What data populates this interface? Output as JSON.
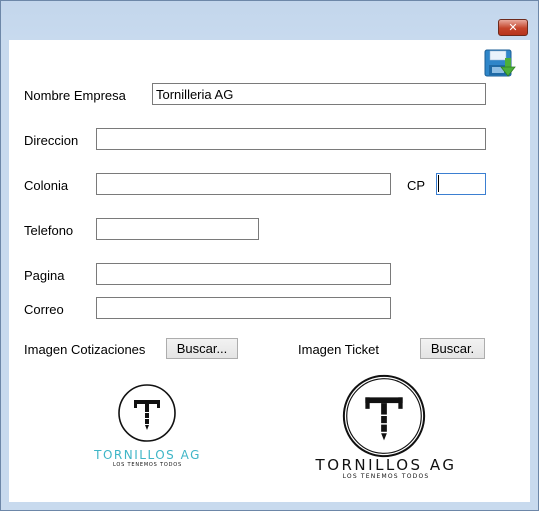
{
  "window": {
    "close_glyph": "✕"
  },
  "toolbar": {
    "save_icon": "save-disk-icon"
  },
  "form": {
    "nombre_empresa": {
      "label": "Nombre Empresa",
      "value": "Tornilleria AG"
    },
    "direccion": {
      "label": "Direccion",
      "value": ""
    },
    "colonia": {
      "label": "Colonia",
      "value": ""
    },
    "cp": {
      "label": "CP",
      "value": ""
    },
    "telefono": {
      "label": "Telefono",
      "value": ""
    },
    "pagina": {
      "label": "Pagina",
      "value": ""
    },
    "correo": {
      "label": "Correo",
      "value": ""
    }
  },
  "images": {
    "cotizaciones": {
      "label": "Imagen Cotizaciones",
      "button": "Buscar..."
    },
    "ticket": {
      "label": "Imagen Ticket",
      "button": "Buscar."
    }
  },
  "logos": {
    "cotizaciones": {
      "brand": "TORNILLOS AG",
      "tagline": "LOS TENEMOS TODOS",
      "color": "#3fb6c7"
    },
    "ticket": {
      "brand": "TORNILLOS AG",
      "tagline": "LOS TENEMOS TODOS",
      "color": "#111111"
    }
  }
}
